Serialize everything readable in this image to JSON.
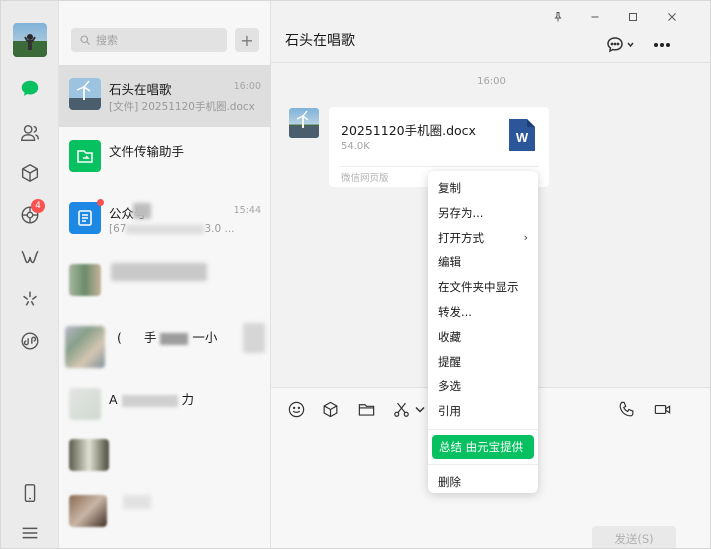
{
  "window": {
    "pin_icon": "pin-icon",
    "min_icon": "minimize-icon",
    "max_icon": "maximize-icon",
    "close_icon": "close-icon"
  },
  "colors": {
    "accent": "#07c160",
    "badge": "#fa5151",
    "word_blue": "#2b579a"
  },
  "sidebar": {
    "badge_count": "4",
    "icons": [
      "chat-icon",
      "contacts-icon",
      "favorites-cube-icon",
      "moments-icon",
      "channels-icon",
      "discover-icon",
      "mini-program-icon",
      "phone-icon",
      "menu-icon"
    ]
  },
  "search": {
    "placeholder": "搜索"
  },
  "chats": [
    {
      "name": "石头在唱歌",
      "sub": "[文件] 20251120手机圈.docx",
      "time": "16:00"
    },
    {
      "name": "文件传输助手"
    },
    {
      "name": "公众号",
      "sub_prefix": "[67",
      "sub_suffix": "3.0 ...",
      "time": "15:44"
    },
    {
      "name_part": "(",
      "name_mid": "手",
      "name_end": "一小",
      "item": "blurred"
    },
    {
      "name_prefix": "A",
      "name_suffix": "力"
    }
  ],
  "conversation": {
    "title": "石头在唱歌",
    "timestamp": "16:00",
    "file": {
      "name": "20251120手机圈.docx",
      "size": "54.0K",
      "source": "微信网页版",
      "type_letter": "W"
    }
  },
  "context_menu": {
    "items": [
      "复制",
      "另存为...",
      "打开方式",
      "编辑",
      "在文件夹中显示",
      "转发...",
      "收藏",
      "提醒",
      "多选",
      "引用"
    ],
    "ai_item": "总结 由元宝提供",
    "delete": "删除"
  },
  "input": {
    "send_label": "发送(S)"
  }
}
